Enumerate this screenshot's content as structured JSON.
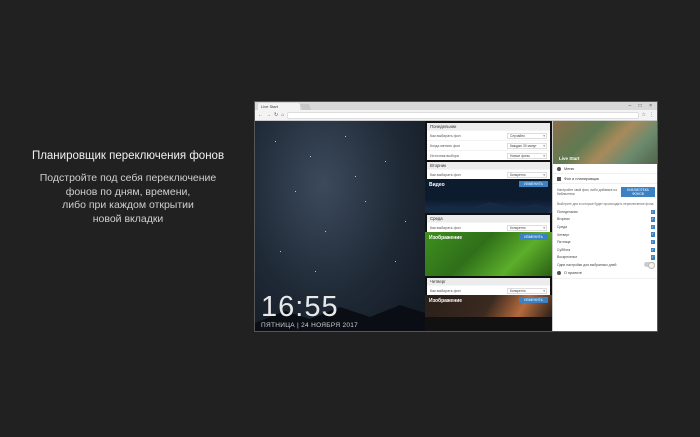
{
  "promo": {
    "title": "Планировщик переключения фонов",
    "subtitle": "Подстройте под себя переключение\nфонов по дням, времени,\nлибо при каждом открытии\nновой вкладки"
  },
  "browser": {
    "tab_title": "Live Start",
    "controls": "– □ ×"
  },
  "clock": {
    "time": "16:55",
    "date": "ПЯТНИЦА | 24 НОЯБРЯ 2017"
  },
  "schedule": {
    "monday": {
      "heading": "Понедельник",
      "rows": [
        {
          "label": "Как выбирать фон",
          "value": "Случайно"
        },
        {
          "label": "Когда менять фон",
          "value": "Каждые 30 минут"
        },
        {
          "label": "Источник выбора",
          "value": "Новые фоны"
        }
      ]
    },
    "tuesday": {
      "heading": "Вторник",
      "row": {
        "label": "Как выбирать фон",
        "value": "Конкретно"
      },
      "media_label": "Видео",
      "button": "ИЗМЕНИТЬ"
    },
    "wednesday": {
      "heading": "Среда",
      "row": {
        "label": "Как выбирать фон",
        "value": "Конкретно"
      },
      "media_label": "Изображение",
      "button": "ИЗМЕНИТЬ"
    },
    "thursday": {
      "heading": "Четверг",
      "row": {
        "label": "Как выбирать фон",
        "value": "Конкретно"
      },
      "media_label": "Изображение",
      "button": "ИЗМЕНИТЬ"
    }
  },
  "panel": {
    "image_label": "Live Start",
    "menu_label": "Меню",
    "backgrounds_label": "Фон и планировщик",
    "desc": "Настройте свой фон, либо добавьте из библиотеки",
    "library_button": "БИБЛИОТЕКА ФОНОВ",
    "note": "Выберите дни в которые будет происходить переключение фона",
    "days": [
      "Понедельник",
      "Вторник",
      "Среда",
      "Четверг",
      "Пятница",
      "Суббота",
      "Воскресенье"
    ],
    "same_settings": "Одни настройки для выбранных дней",
    "about": "О проекте"
  },
  "colors": {
    "accent": "#3b82c4",
    "page_bg": "#212121"
  }
}
